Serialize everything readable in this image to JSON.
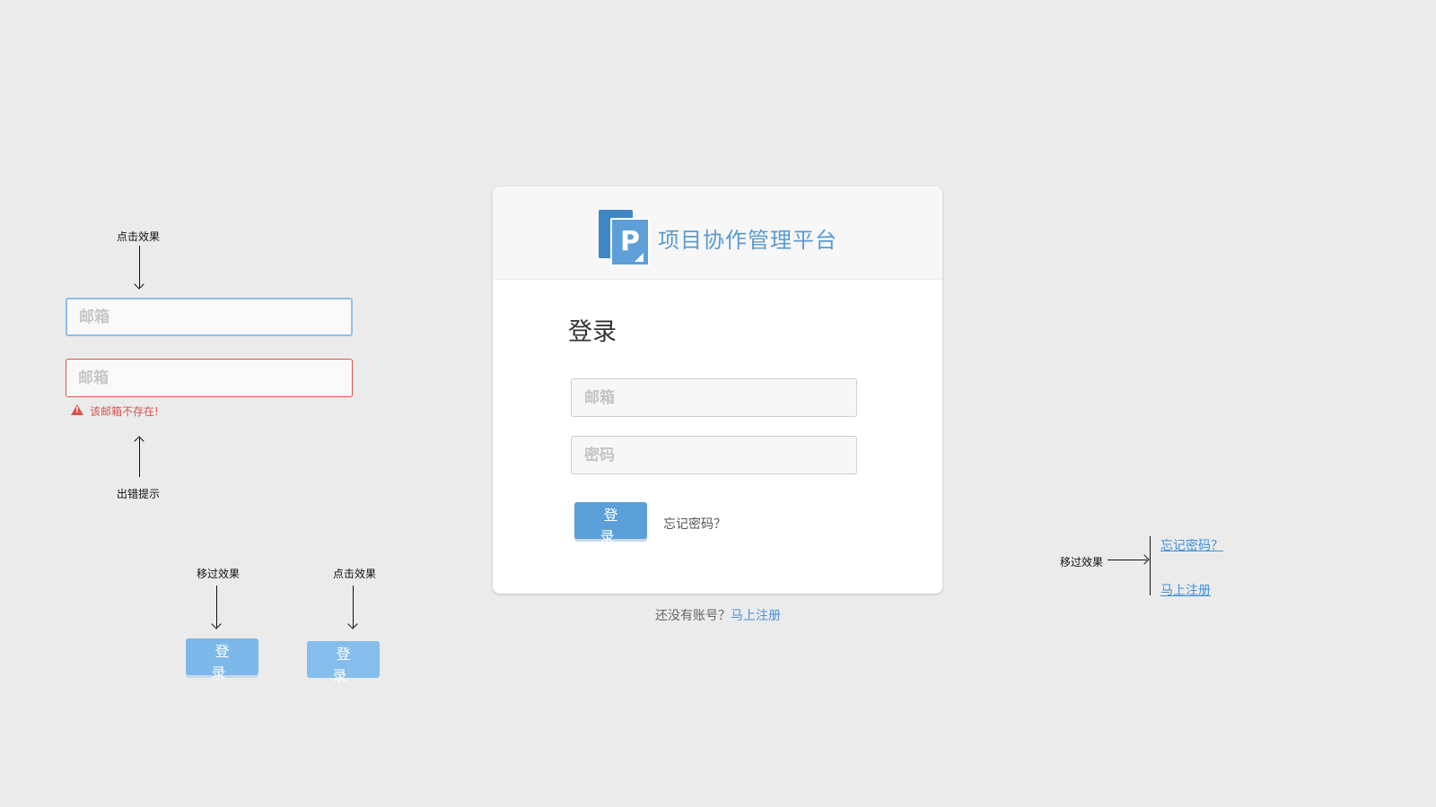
{
  "brand": {
    "logo_letter": "P",
    "title": "项目协作管理平台"
  },
  "login": {
    "heading": "登录",
    "email_placeholder": "邮箱",
    "password_placeholder": "密码",
    "submit_label": "登 录",
    "forgot_label": "忘记密码？"
  },
  "signup": {
    "prompt": "还没有账号？",
    "link": "马上注册"
  },
  "annotations": {
    "input_click_effect": "点击效果",
    "demo_email_placeholder": "邮箱",
    "error_message": "该邮箱不存在!",
    "error_hint": "出错提示",
    "button_hover_effect": "移过效果",
    "button_click_effect": "点击效果",
    "demo_button_label": "登 录",
    "link_hover_effect": "移过效果",
    "hover_forgot": "忘记密码？",
    "hover_signup": "马上注册"
  },
  "colors": {
    "background": "#ebebeb",
    "brand_blue": "#5a9ad2",
    "button_blue": "#5b9fd8",
    "error_red": "#d9534f",
    "focus_border": "#8ec0ea"
  }
}
